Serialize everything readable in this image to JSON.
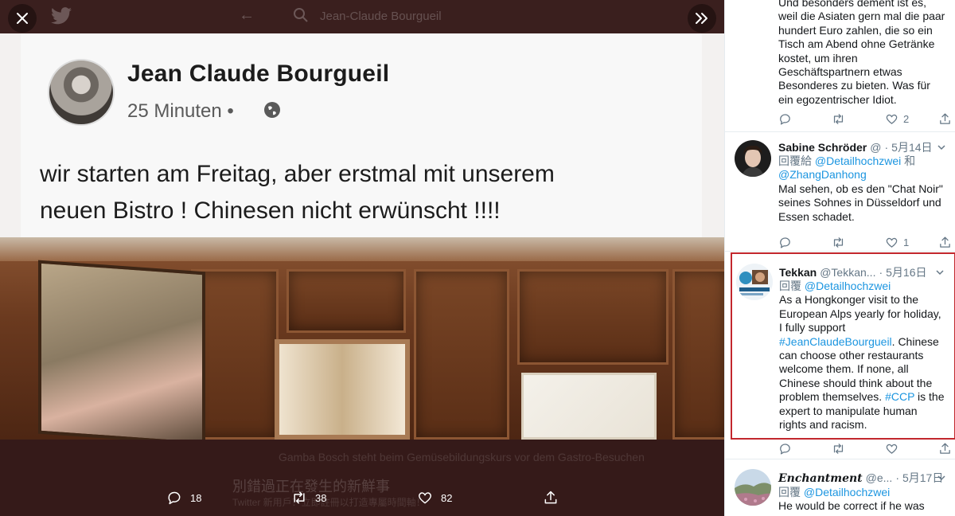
{
  "viewer": {
    "top_search_text": "Jean-Claude Bourgueil",
    "post": {
      "author": "Jean Claude Bourgueil",
      "time": "25 Minuten •",
      "text_line1": "wir starten am Freitag, aber erstmal mit unserem",
      "text_line2": "neuen Bistro ! Chinesen nicht erwünscht !!!!"
    },
    "caption_ghost_1": "Gamba Bosch steht beim Gemüsebildungskurs vor dem Gastro-Besuchen",
    "caption_ghost_2": "別錯過正在發生的新鮮事",
    "caption_ghost_3": "Twitter 新用戶？立即註冊以打造專屬時間軸！",
    "actions": {
      "replies": "18",
      "retweets": "38",
      "likes": "82"
    },
    "icons": [
      "close-icon",
      "expand-icon",
      "reply-icon",
      "retweet-icon",
      "like-icon",
      "share-icon"
    ]
  },
  "replies": [
    {
      "text": "Und besonders dement ist es, weil die Asiaten gern mal die paar hundert Euro zahlen, die so ein Tisch am Abend ohne Getränke kostet, um ihren Geschäftspartnern etwas Besonderes zu bieten.  Was für ein egozentrischer Idiot.",
      "replies": "",
      "retweets": "",
      "likes": "2"
    },
    {
      "name": "Sabine Schröder",
      "handle": "@",
      "dot": "·",
      "date": "5月14日",
      "reply_prefix": "回覆給",
      "mention_1": "@Detailhochzwei",
      "reply_and": "和",
      "mention_2": "@ZhangDanhong",
      "text": "Mal sehen, ob es den \"Chat Noir\" seines Sohnes in Düsseldorf und Essen schadet.",
      "replies": "",
      "retweets": "",
      "likes": "1"
    },
    {
      "name": "Tekkan",
      "handle": "@Tekkan...",
      "dot": "·",
      "date": "5月16日",
      "reply_prefix": "回覆",
      "mention_1": "@Detailhochzwei",
      "text_1": "As a Hongkonger visit to the European Alps yearly for holiday, I fully support ",
      "hashtag_1": "#JeanClaudeBourgueil",
      "text_2": ". Chinese can choose other restaurants welcome them. If none, all Chinese should think about the problem themselves. ",
      "hashtag_2": "#CCP",
      "text_3": " is the expert to manipulate human rights and racism.",
      "replies": "",
      "retweets": "",
      "likes": ""
    },
    {
      "name": "Enchantment",
      "handle": "@e...",
      "dot": "·",
      "date": "5月17日",
      "reply_prefix": "回覆",
      "mention_1": "@Detailhochzwei",
      "text": "He would be correct if he was"
    }
  ],
  "colors": {
    "link": "#1b95e0",
    "highlight_border": "#c2272d",
    "viewer_bg": "#351a19"
  }
}
